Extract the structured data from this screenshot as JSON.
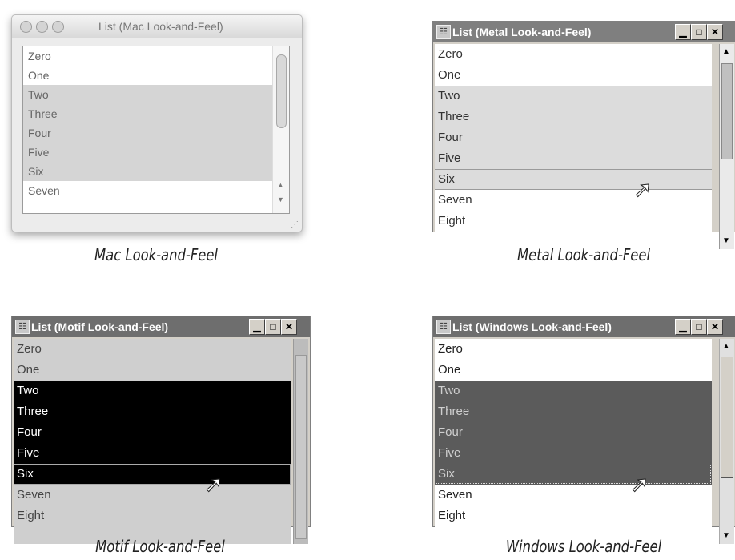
{
  "items": [
    "Zero",
    "One",
    "Two",
    "Three",
    "Four",
    "Five",
    "Six",
    "Seven",
    "Eight"
  ],
  "mac": {
    "title": "List (Mac Look-and-Feel)",
    "caption": "Mac Look-and-Feel",
    "visible_items": [
      "Zero",
      "One",
      "Two",
      "Three",
      "Four",
      "Five",
      "Six",
      "Seven"
    ],
    "selected": [
      "Two",
      "Three",
      "Four",
      "Five",
      "Six"
    ]
  },
  "metal": {
    "title": "List (Metal Look-and-Feel)",
    "caption": "Metal Look-and-Feel",
    "selected": [
      "Two",
      "Three",
      "Four",
      "Five",
      "Six"
    ],
    "lead": "Six"
  },
  "motif": {
    "title": "List (Motif Look-and-Feel)",
    "caption": "Motif Look-and-Feel",
    "selected": [
      "Two",
      "Three",
      "Four",
      "Five",
      "Six"
    ],
    "lead": "Six"
  },
  "windows": {
    "title": "List (Windows Look-and-Feel)",
    "caption": "Windows Look-and-Feel",
    "selected": [
      "Two",
      "Three",
      "Four",
      "Five",
      "Six"
    ],
    "lead": "Six"
  },
  "controls": {
    "minimize": "▁",
    "maximize": "□",
    "close": "✕"
  },
  "icons": {
    "window-icon": "window-app-icon",
    "cursor": "arrow-cursor-icon"
  }
}
